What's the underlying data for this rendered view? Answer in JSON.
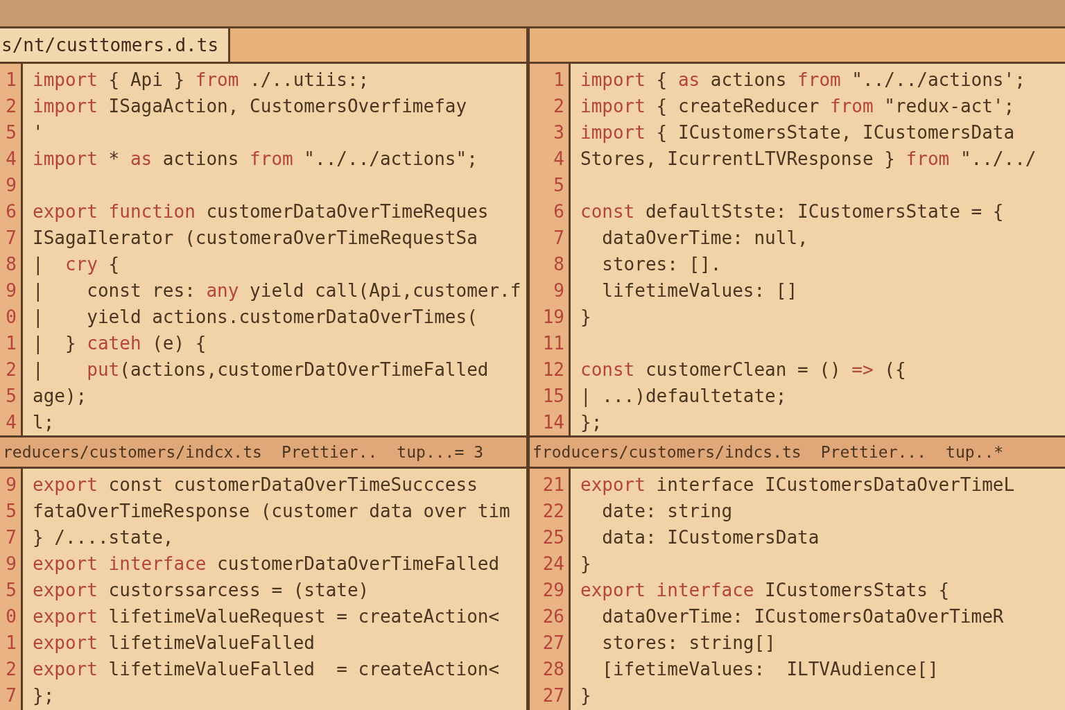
{
  "panes": [
    {
      "tab": {
        "label": "s/nt/custtomers.d.ts",
        "selected": true
      },
      "lines": [
        {
          "number": "1",
          "tokens": [
            {
              "kind": "keyword",
              "text": "import"
            },
            {
              "kind": "plain",
              "text": " { Api } "
            },
            {
              "kind": "keyword",
              "text": "from"
            },
            {
              "kind": "plain",
              "text": " ./..utiis:;"
            }
          ]
        },
        {
          "number": "2",
          "tokens": [
            {
              "kind": "keyword",
              "text": "import"
            },
            {
              "kind": "plain",
              "text": " ISagaAction, CustomersOverfimefay"
            }
          ]
        },
        {
          "number": "5",
          "tokens": [
            {
              "kind": "plain",
              "text": "'"
            }
          ]
        },
        {
          "number": "4",
          "tokens": [
            {
              "kind": "keyword",
              "text": "import"
            },
            {
              "kind": "plain",
              "text": " * "
            },
            {
              "kind": "keyword",
              "text": "as"
            },
            {
              "kind": "plain",
              "text": " actions "
            },
            {
              "kind": "keyword",
              "text": "from"
            },
            {
              "kind": "plain",
              "text": " \"../../actions\";"
            }
          ]
        },
        {
          "number": "9"
        },
        {
          "number": "6",
          "tokens": [
            {
              "kind": "keyword",
              "text": "export function"
            },
            {
              "kind": "plain",
              "text": " customerDataOverTimeReques"
            }
          ]
        },
        {
          "number": "7",
          "tokens": [
            {
              "kind": "plain",
              "text": "ISagaIlerator (customeraOverTimeRequestSa"
            }
          ]
        },
        {
          "number": "8",
          "tokens": [
            {
              "kind": "plain",
              "text": "|  "
            },
            {
              "kind": "keyword",
              "text": "cry"
            },
            {
              "kind": "plain",
              "text": " {"
            }
          ]
        },
        {
          "number": "9",
          "tokens": [
            {
              "kind": "plain",
              "text": "|    const res: "
            },
            {
              "kind": "keyword",
              "text": "any"
            },
            {
              "kind": "plain",
              "text": " yield call(Api,customer.f"
            }
          ]
        },
        {
          "number": "0",
          "tokens": [
            {
              "kind": "plain",
              "text": "|    yield actions.customerDataOverTimes("
            }
          ]
        },
        {
          "number": "1",
          "tokens": [
            {
              "kind": "plain",
              "text": "|  } "
            },
            {
              "kind": "keyword",
              "text": "cateh"
            },
            {
              "kind": "plain",
              "text": " (e) {"
            }
          ]
        },
        {
          "number": "2",
          "tokens": [
            {
              "kind": "plain",
              "text": "|    "
            },
            {
              "kind": "keyword",
              "text": "put"
            },
            {
              "kind": "plain",
              "text": "(actions,customerDatOverTimeFalled"
            }
          ]
        },
        {
          "number": "5",
          "tokens": [
            {
              "kind": "plain",
              "text": "age);"
            }
          ]
        },
        {
          "number": "4",
          "tokens": [
            {
              "kind": "plain",
              "text": "l;"
            }
          ]
        }
      ]
    },
    {
      "lines": [
        {
          "number": "1",
          "tokens": [
            {
              "kind": "keyword",
              "text": "import"
            },
            {
              "kind": "plain",
              "text": " { "
            },
            {
              "kind": "keyword",
              "text": "as"
            },
            {
              "kind": "plain",
              "text": " actions "
            },
            {
              "kind": "keyword",
              "text": "from"
            },
            {
              "kind": "plain",
              "text": " \"../../actions';"
            }
          ]
        },
        {
          "number": "2",
          "tokens": [
            {
              "kind": "keyword",
              "text": "import"
            },
            {
              "kind": "plain",
              "text": " { createReducer "
            },
            {
              "kind": "keyword",
              "text": "from"
            },
            {
              "kind": "plain",
              "text": " \"redux-act';"
            }
          ]
        },
        {
          "number": "3",
          "tokens": [
            {
              "kind": "keyword",
              "text": "import"
            },
            {
              "kind": "plain",
              "text": " { ICustomersState, ICustomersData"
            }
          ]
        },
        {
          "number": "4",
          "tokens": [
            {
              "kind": "plain",
              "text": "Stores, IcurrentLTVResponse } "
            },
            {
              "kind": "keyword",
              "text": "from"
            },
            {
              "kind": "plain",
              "text": " \"../../"
            }
          ]
        },
        {
          "number": "5"
        },
        {
          "number": "6",
          "tokens": [
            {
              "kind": "keyword",
              "text": "const"
            },
            {
              "kind": "plain",
              "text": " defaultStste: ICustomersState = {"
            }
          ]
        },
        {
          "number": "7",
          "tokens": [
            {
              "kind": "plain",
              "text": "  dataOverTime: null,"
            }
          ]
        },
        {
          "number": "8",
          "tokens": [
            {
              "kind": "plain",
              "text": "  stores: []."
            }
          ]
        },
        {
          "number": "9",
          "tokens": [
            {
              "kind": "plain",
              "text": "  lifetimeValues: []"
            }
          ]
        },
        {
          "number": "19",
          "tokens": [
            {
              "kind": "plain",
              "text": "}"
            }
          ]
        },
        {
          "number": "11"
        },
        {
          "number": "12",
          "tokens": [
            {
              "kind": "keyword",
              "text": "const"
            },
            {
              "kind": "plain",
              "text": " customerClean = () "
            },
            {
              "kind": "keyword",
              "text": "=>"
            },
            {
              "kind": "plain",
              "text": " ({"
            }
          ]
        },
        {
          "number": "15",
          "tokens": [
            {
              "kind": "plain",
              "text": "| ...)defaultetate;"
            }
          ]
        },
        {
          "number": "14",
          "tokens": [
            {
              "kind": "plain",
              "text": "};"
            }
          ]
        }
      ]
    },
    {
      "status": [
        "reducers/customers/indcx.ts",
        "Prettier..",
        "tup...= 3"
      ],
      "lines": [
        {
          "number": "9",
          "tokens": [
            {
              "kind": "keyword",
              "text": "export"
            },
            {
              "kind": "plain",
              "text": " const customerDataOverTimeSucccess"
            }
          ]
        },
        {
          "number": "5",
          "tokens": [
            {
              "kind": "plain",
              "text": "fataOverTimeResponse (customer data over tim"
            }
          ]
        },
        {
          "number": "7",
          "tokens": [
            {
              "kind": "plain",
              "text": "} /....state,"
            }
          ]
        },
        {
          "number": "9",
          "tokens": [
            {
              "kind": "keyword",
              "text": "export interface"
            },
            {
              "kind": "plain",
              "text": " customerDataOverTimeFalled"
            }
          ]
        },
        {
          "number": "5",
          "tokens": [
            {
              "kind": "keyword",
              "text": "export"
            },
            {
              "kind": "plain",
              "text": " custorssarcess = (state)"
            }
          ]
        },
        {
          "number": "0",
          "tokens": [
            {
              "kind": "keyword",
              "text": "export"
            },
            {
              "kind": "plain",
              "text": " lifetimeValueRequest = createAction<"
            }
          ]
        },
        {
          "number": "1",
          "tokens": [
            {
              "kind": "keyword",
              "text": "export"
            },
            {
              "kind": "plain",
              "text": " lifetimeValueFalled"
            }
          ]
        },
        {
          "number": "2",
          "tokens": [
            {
              "kind": "keyword",
              "text": "export"
            },
            {
              "kind": "plain",
              "text": " lifetimeValueFalled  = createAction<"
            }
          ]
        },
        {
          "number": "7",
          "tokens": [
            {
              "kind": "plain",
              "text": "};"
            }
          ]
        }
      ]
    },
    {
      "status": [
        "froducers/customers/indcs.ts",
        "Prettier...",
        "tup..*"
      ],
      "lines": [
        {
          "number": "21",
          "tokens": [
            {
              "kind": "keyword",
              "text": "export"
            },
            {
              "kind": "plain",
              "text": " interface ICustomersDataOverTimeL"
            }
          ]
        },
        {
          "number": "22",
          "tokens": [
            {
              "kind": "plain",
              "text": "  date: string"
            }
          ]
        },
        {
          "number": "25",
          "tokens": [
            {
              "kind": "plain",
              "text": "  data: ICustomersData"
            }
          ]
        },
        {
          "number": "24",
          "tokens": [
            {
              "kind": "plain",
              "text": "}"
            }
          ]
        },
        {
          "number": "29",
          "tokens": [
            {
              "kind": "keyword",
              "text": "export interface"
            },
            {
              "kind": "plain",
              "text": " ICustomersStats {"
            }
          ]
        },
        {
          "number": "26",
          "tokens": [
            {
              "kind": "plain",
              "text": "  dataOverTime: ICustomersOataOverTimeR"
            }
          ]
        },
        {
          "number": "27",
          "tokens": [
            {
              "kind": "plain",
              "text": "  stores: string[]"
            }
          ]
        },
        {
          "number": "28",
          "tokens": [
            {
              "kind": "plain",
              "text": "  [ifetimeValues:  ILTVAudience[]"
            }
          ]
        },
        {
          "number": "27",
          "tokens": [
            {
              "kind": "plain",
              "text": "}"
            }
          ]
        }
      ]
    }
  ]
}
